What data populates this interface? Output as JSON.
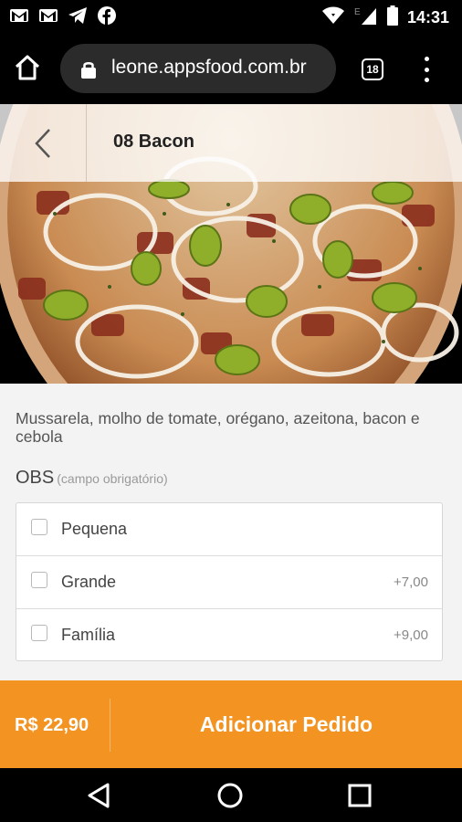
{
  "status_bar": {
    "time": "14:31",
    "icons": [
      "gmail-icon",
      "gmail-icon",
      "telegram-icon",
      "facebook-icon",
      "wifi-icon",
      "signal-icon",
      "battery-icon"
    ]
  },
  "browser": {
    "url": "leone.appsfood.com.br",
    "tab_count": "18"
  },
  "product": {
    "title": "08 Bacon",
    "description": "Mussarela, molho de tomate, orégano, azeitona, bacon e cebola"
  },
  "obs": {
    "label": "OBS",
    "hint": "(campo obrigatório)"
  },
  "options": [
    {
      "label": "Pequena",
      "price": ""
    },
    {
      "label": "Grande",
      "price": "+7,00"
    },
    {
      "label": "Família",
      "price": "+9,00"
    }
  ],
  "order": {
    "total": "R$ 22,90",
    "button_label": "Adicionar Pedido"
  },
  "colors": {
    "accent": "#f29322",
    "background": "#f3f3f3"
  }
}
